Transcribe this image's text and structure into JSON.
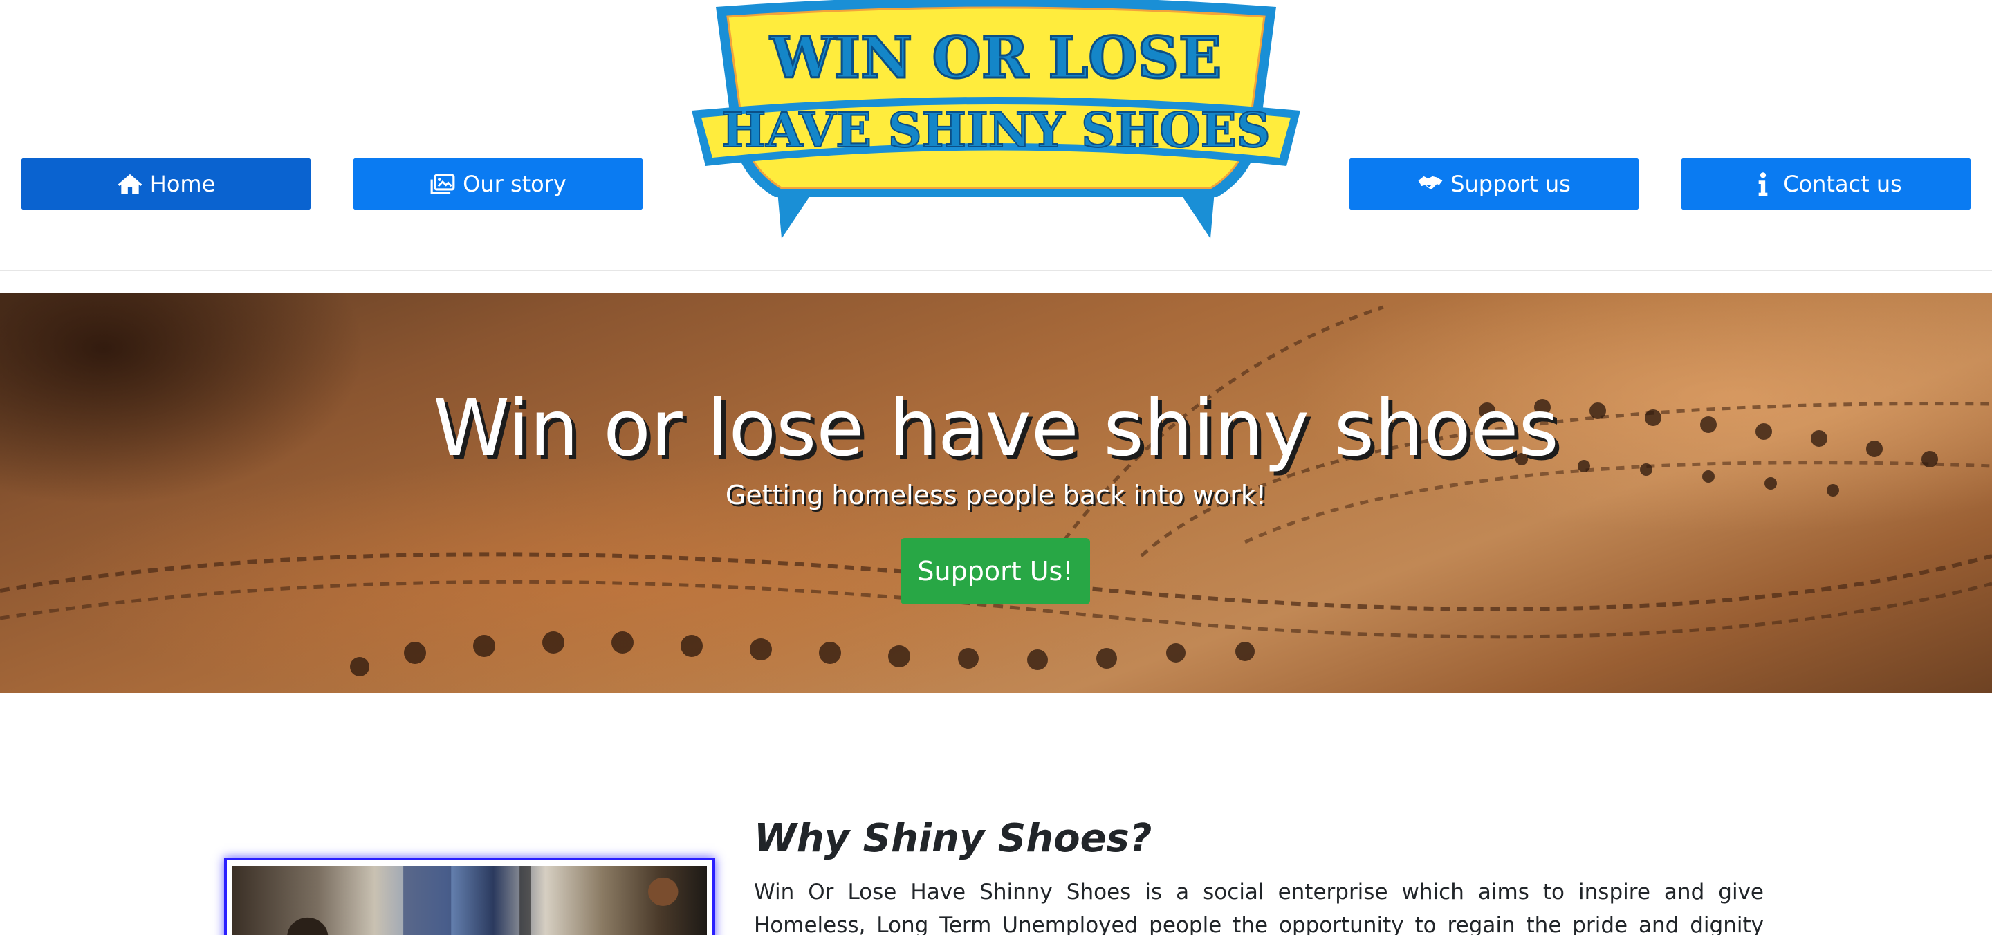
{
  "nav": {
    "items": [
      {
        "label": "Home",
        "icon": "home-icon"
      },
      {
        "label": "Our story",
        "icon": "images-icon"
      },
      {
        "label": "Support us",
        "icon": "handshake-icon"
      },
      {
        "label": "Contact us",
        "icon": "info-icon"
      }
    ],
    "active": "Home"
  },
  "logo": {
    "line1": "WIN OR LOSE",
    "line2": "HAVE SHINY SHOES",
    "colors": {
      "banner_fill": "#ffec3d",
      "outline": "#1a8fd6",
      "text": "#1486c8"
    }
  },
  "hero": {
    "title": "Win or lose have shiny shoes",
    "subtitle": "Getting homeless people back into work!",
    "cta_label": "Support Us!"
  },
  "about": {
    "heading": "Why Shiny Shoes?",
    "text": "Win Or Lose Have Shinny Shoes is a social enterprise which aims to inspire and give Homeless, Long Term Unemployed people the opportunity to regain the pride and dignity associated with work....."
  },
  "colors": {
    "nav_button": "#0a7bf2",
    "nav_button_active": "#0a63d0",
    "cta": "#28a745",
    "photo_border": "#2a1fff"
  }
}
